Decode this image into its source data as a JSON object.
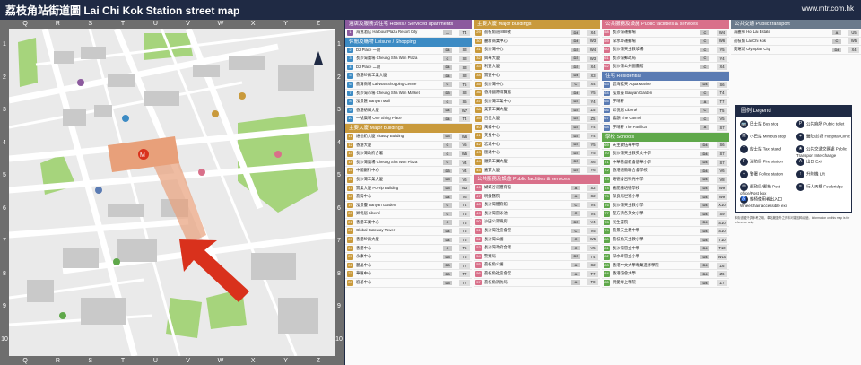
{
  "header": {
    "title": "荔枝角站街道圖 Lai Chi Kok Station street map",
    "website": "www.mtr.com.hk"
  },
  "map": {
    "columns": [
      "Q",
      "R",
      "S",
      "T",
      "U",
      "V",
      "W",
      "X",
      "Y",
      "Z"
    ],
    "rows": [
      "1",
      "2",
      "3",
      "4",
      "5",
      "6",
      "7",
      "8",
      "9",
      "10"
    ],
    "station_label": "荔枝角",
    "streets": [
      "CHEUNG SHA WAN ROAD",
      "CASTLE PEAK ROAD",
      "LAI CHI KOK ROAD",
      "TUNG CHAU STREET",
      "WING HONG STREET",
      "PO LUN STREET",
      "LAI WAN ROAD",
      "YUET LUN STREET",
      "CHEUNG YEE STREET"
    ],
    "colors": {
      "water": "#a6c8e6",
      "park": "#a6d47c",
      "road": "#ffffff",
      "building": "#cfcfcf",
      "station": "#e8a07a",
      "arrow": "#d9311c"
    }
  },
  "panel": {
    "col1": {
      "sections": [
        {
          "title": "酒店及服務式住宅 Hotels / Serviced apartments",
          "color": "#8c5a9e",
          "items": [
            {
              "n": "1",
              "name": "海逸酒店 Harbour Plaza Resort City",
              "ex": "—",
              "grid": "T4"
            }
          ]
        },
        {
          "title": "休閒及購物 Leisure / Shopping",
          "color": "#3c8bc4",
          "items": [
            {
              "n": "2",
              "name": "D2 Place 一期",
              "ex": "D4",
              "grid": "S3"
            },
            {
              "n": "3",
              "name": "長沙灣廣場 Cheung Sha Wan Plaza",
              "ex": "C",
              "grid": "S3"
            },
            {
              "n": "4",
              "name": "D2 Place 二期",
              "ex": "D4",
              "grid": "S3"
            },
            {
              "n": "5",
              "name": "香港紗廠工業大廈",
              "ex": "D4",
              "grid": "S3"
            },
            {
              "n": "6",
              "name": "荔灣商場 Lai Wan Shopping Centre",
              "ex": "C",
              "grid": "T5"
            },
            {
              "n": "7",
              "name": "長沙灣市場 Cheung Sha Wan Market",
              "ex": "D3",
              "grid": "S3"
            },
            {
              "n": "8",
              "name": "泓景匯 Banyan Mall",
              "ex": "C",
              "grid": "S5"
            },
            {
              "n": "9",
              "name": "香港紡織大廈",
              "ex": "D4",
              "grid": "W7"
            },
            {
              "n": "10",
              "name": "一號廣場 One Shing Place",
              "ex": "D4",
              "grid": "T4"
            }
          ]
        },
        {
          "title": "主要大廈 Major buildings",
          "color": "#c99a3c",
          "items": [
            {
              "n": "11",
              "name": "維他奶大廈 Vitasoy Building",
              "ex": "D3",
              "grid": "W6"
            },
            {
              "n": "12",
              "name": "香港大廈",
              "ex": "C",
              "grid": "V5"
            },
            {
              "n": "13",
              "name": "長沙灣政府合署",
              "ex": "C",
              "grid": "W5"
            },
            {
              "n": "14",
              "name": "長沙灣廣場 Cheung Sha Wan Plaza",
              "ex": "C",
              "grid": "V4"
            },
            {
              "n": "15",
              "name": "中國銀行中心",
              "ex": "D3",
              "grid": "V4"
            },
            {
              "n": "16",
              "name": "長沙灣工業大廈",
              "ex": "D3",
              "grid": "V6"
            },
            {
              "n": "17",
              "name": "寶業大廈 Po Yip Building",
              "ex": "D3",
              "grid": "W3"
            },
            {
              "n": "18",
              "name": "荔灣中心",
              "ex": "D4",
              "grid": "V6"
            },
            {
              "n": "19",
              "name": "泓景臺 Banyan Garden",
              "ex": "C",
              "grid": "T4"
            },
            {
              "n": "20",
              "name": "昇悅居 Liberté",
              "ex": "C",
              "grid": "T5"
            },
            {
              "n": "21",
              "name": "香港工業中心",
              "ex": "C",
              "grid": "T6"
            },
            {
              "n": "22",
              "name": "Global Gateway Tower",
              "ex": "D4",
              "grid": "T6"
            },
            {
              "n": "23",
              "name": "香港紗廠大廈",
              "ex": "D4",
              "grid": "T6"
            },
            {
              "n": "24",
              "name": "香港中心",
              "ex": "C",
              "grid": "T5"
            },
            {
              "n": "25",
              "name": "永康中心",
              "ex": "D3",
              "grid": "T6"
            },
            {
              "n": "26",
              "name": "麗晶中心",
              "ex": "D3",
              "grid": "T7"
            },
            {
              "n": "27",
              "name": "華匯中心",
              "ex": "D3",
              "grid": "T7"
            },
            {
              "n": "28",
              "name": "宏基中心",
              "ex": "D3",
              "grid": "T7"
            }
          ]
        }
      ]
    },
    "col2": {
      "sections": [
        {
          "title": "主要大廈 Major buildings",
          "color": "#c99a3c",
          "items": [
            {
              "n": "29",
              "name": "荔枝角道 888號",
              "ex": "D4",
              "grid": "X4"
            },
            {
              "n": "30",
              "name": "麗新商業中心",
              "ex": "D4",
              "grid": "W3"
            },
            {
              "n": "31",
              "name": "長沙灣中心",
              "ex": "D3",
              "grid": "W4"
            },
            {
              "n": "32",
              "name": "興華大廈",
              "ex": "D3",
              "grid": "W3"
            },
            {
              "n": "33",
              "name": "利豐大廈",
              "ex": "D3",
              "grid": "X4"
            },
            {
              "n": "34",
              "name": "寶豐中心",
              "ex": "D4",
              "grid": "X3"
            },
            {
              "n": "35",
              "name": "長沙灣中心",
              "ex": "C",
              "grid": "X4"
            },
            {
              "n": "36",
              "name": "香港國際博覽館",
              "ex": "D4",
              "grid": "Y5"
            },
            {
              "n": "37",
              "name": "長沙灣工業中心",
              "ex": "D3",
              "grid": "Y4"
            },
            {
              "n": "38",
              "name": "美寶工業大廈",
              "ex": "D3",
              "grid": "Z5"
            },
            {
              "n": "39",
              "name": "百佳大廈",
              "ex": "D3",
              "grid": "Z5"
            },
            {
              "n": "40",
              "name": "萬泰中心",
              "ex": "D3",
              "grid": "Y4"
            },
            {
              "n": "41",
              "name": "英皇中心",
              "ex": "D3",
              "grid": "Y4"
            },
            {
              "n": "42",
              "name": "宏達中心",
              "ex": "D3",
              "grid": "Y5"
            },
            {
              "n": "43",
              "name": "匯達中心",
              "ex": "D3",
              "grid": "Y5"
            },
            {
              "n": "44",
              "name": "順興工業大廈",
              "ex": "D3",
              "grid": "X6"
            },
            {
              "n": "45",
              "name": "嘉寶大廈",
              "ex": "D3",
              "grid": "Y6"
            }
          ]
        },
        {
          "title": "公共服務及設施 Public facilities & services",
          "color": "#d9708a",
          "items": [
            {
              "n": "46",
              "name": "蝴蝶谷道體育館",
              "ex": "A",
              "grid": "S2"
            },
            {
              "n": "47",
              "name": "明愛醫院",
              "ex": "A",
              "grid": "S2"
            },
            {
              "n": "48",
              "name": "長沙灣體育館",
              "ex": "C",
              "grid": "V4"
            },
            {
              "n": "49",
              "name": "長沙灣游泳池",
              "ex": "C",
              "grid": "V4"
            },
            {
              "n": "50",
              "name": "沙田公眾殮房",
              "ex": "D3",
              "grid": "V4"
            },
            {
              "n": "51",
              "name": "長沙灣社區會堂",
              "ex": "C",
              "grid": "V5"
            },
            {
              "n": "52",
              "name": "長沙灣公園",
              "ex": "C",
              "grid": "W5"
            },
            {
              "n": "53",
              "name": "長沙灣政府合署",
              "ex": "C",
              "grid": "V5"
            },
            {
              "n": "54",
              "name": "警察局",
              "ex": "D3",
              "grid": "T4"
            },
            {
              "n": "55",
              "name": "荔枝角公園",
              "ex": "A",
              "grid": "S2"
            },
            {
              "n": "56",
              "name": "荔枝角社區會堂",
              "ex": "A",
              "grid": "T7"
            },
            {
              "n": "57",
              "name": "荔枝角消防局",
              "ex": "A",
              "grid": "T8"
            }
          ]
        }
      ]
    },
    "col3": {
      "sections": [
        {
          "title": "公共服務及設施 Public facilities & services",
          "color": "#d9708a",
          "items": [
            {
              "n": "58",
              "name": "長沙灣運動場",
              "ex": "C",
              "grid": "W4"
            },
            {
              "n": "59",
              "name": "深水埗運動場",
              "ex": "C",
              "grid": "W6"
            },
            {
              "n": "60",
              "name": "長沙灣天主教墳場",
              "ex": "C",
              "grid": "Y5"
            },
            {
              "n": "61",
              "name": "長沙灣郵政局",
              "ex": "C",
              "grid": "Y4"
            },
            {
              "n": "62",
              "name": "長沙灣公共圖書館",
              "ex": "C",
              "grid": "X4"
            }
          ]
        },
        {
          "title": "住宅 Residential",
          "color": "#5a7bb3",
          "items": [
            {
              "n": "63",
              "name": "碧海藍天 Aqua Marine",
              "ex": "D4",
              "grid": "S6"
            },
            {
              "n": "64",
              "name": "泓景臺 Banyan Garden",
              "ex": "C",
              "grid": "T4"
            },
            {
              "n": "65",
              "name": "宇晴軒",
              "ex": "A",
              "grid": "T7"
            },
            {
              "n": "66",
              "name": "昇悅居 Liberté",
              "ex": "C",
              "grid": "T5"
            },
            {
              "n": "67",
              "name": "喜韻 The Carmel",
              "ex": "C",
              "grid": "V5"
            },
            {
              "n": "68",
              "name": "宇晴軒 The Pacifica",
              "ex": "A",
              "grid": "S7"
            }
          ]
        },
        {
          "title": "學校 Schools",
          "color": "#5fa84a",
          "items": [
            {
              "n": "69",
              "name": "天主教伍華中學",
              "ex": "D4",
              "grid": "S6"
            },
            {
              "n": "70",
              "name": "長沙灣天主教英文中學",
              "ex": "D4",
              "grid": "S7"
            },
            {
              "n": "71",
              "name": "中華基督教會基華小學",
              "ex": "D4",
              "grid": "S7"
            },
            {
              "n": "72",
              "name": "香港道教聯合會學校",
              "ex": "D4",
              "grid": "V6"
            },
            {
              "n": "73",
              "name": "路德會呂祥光中學",
              "ex": "D4",
              "grid": "V8"
            },
            {
              "n": "74",
              "name": "嘉諾撒培德學校",
              "ex": "D4",
              "grid": "W9"
            },
            {
              "n": "75",
              "name": "保良局世德小學",
              "ex": "D4",
              "grid": "W9"
            },
            {
              "n": "76",
              "name": "長沙灣天主教小學",
              "ex": "D4",
              "grid": "X10"
            },
            {
              "n": "77",
              "name": "聖方濟各英文小學",
              "ex": "D4",
              "grid": "S9"
            },
            {
              "n": "78",
              "name": "民生書院",
              "ex": "D4",
              "grid": "S10"
            },
            {
              "n": "79",
              "name": "荔景天主教中學",
              "ex": "D4",
              "grid": "S10"
            },
            {
              "n": "80",
              "name": "荔枝角天主教小學",
              "ex": "D4",
              "grid": "T10"
            },
            {
              "n": "81",
              "name": "長沙灣官立中學",
              "ex": "D4",
              "grid": "T10"
            },
            {
              "n": "82",
              "name": "深水埗官立小學",
              "ex": "D4",
              "grid": "W10"
            },
            {
              "n": "83",
              "name": "香港中文大學專業進修學院",
              "ex": "D4",
              "grid": "Z6"
            },
            {
              "n": "84",
              "name": "香港浸會大學",
              "ex": "D4",
              "grid": "Z6"
            },
            {
              "n": "85",
              "name": "明愛專上學院",
              "ex": "D4",
              "grid": "Z7"
            }
          ]
        }
      ]
    },
    "col4": {
      "title": "公共交通 Public transport",
      "color": "#6a7a8c",
      "transport": [
        {
          "name": "海麗邨 Hoi Lai Estate",
          "ex": "A",
          "grid": "U5"
        },
        {
          "name": "荔枝角 Lai Chi Kok",
          "ex": "C",
          "grid": "W5"
        },
        {
          "name": "奧運城 Olympian City",
          "ex": "D4",
          "grid": "X4"
        }
      ],
      "legend": {
        "title": "圖例 Legend",
        "items": [
          {
            "icon": "🚌",
            "label": "巴士站 Bus stop"
          },
          {
            "icon": "P",
            "label": "公共廁所 Public toilet"
          },
          {
            "icon": "M",
            "label": "小巴站 Minibus stop"
          },
          {
            "icon": "+",
            "label": "醫院/診所 Hospital/Clinic"
          },
          {
            "icon": "T",
            "label": "的士站 Taxi stand"
          },
          {
            "icon": "★",
            "label": "公共交通交匯處 Public Transport Interchange"
          },
          {
            "icon": "F",
            "label": "消防局 Fire station"
          },
          {
            "icon": "A",
            "label": "出口 Exit"
          },
          {
            "icon": "♦",
            "label": "警署 Police station"
          },
          {
            "icon": "↑",
            "label": "升降機 Lift"
          },
          {
            "icon": "✉",
            "label": "郵政局/郵箱 Post office/Post box"
          },
          {
            "icon": "≡",
            "label": "行人天橋 Footbridge"
          },
          {
            "icon": "♿",
            "label": "輪椅使用者出入口 Wheelchair accessible exit"
          }
        ]
      },
      "note": "本街道圖只供參考之用，車站範圍外之資料可能因時改變。Information on this map is for reference only."
    }
  }
}
